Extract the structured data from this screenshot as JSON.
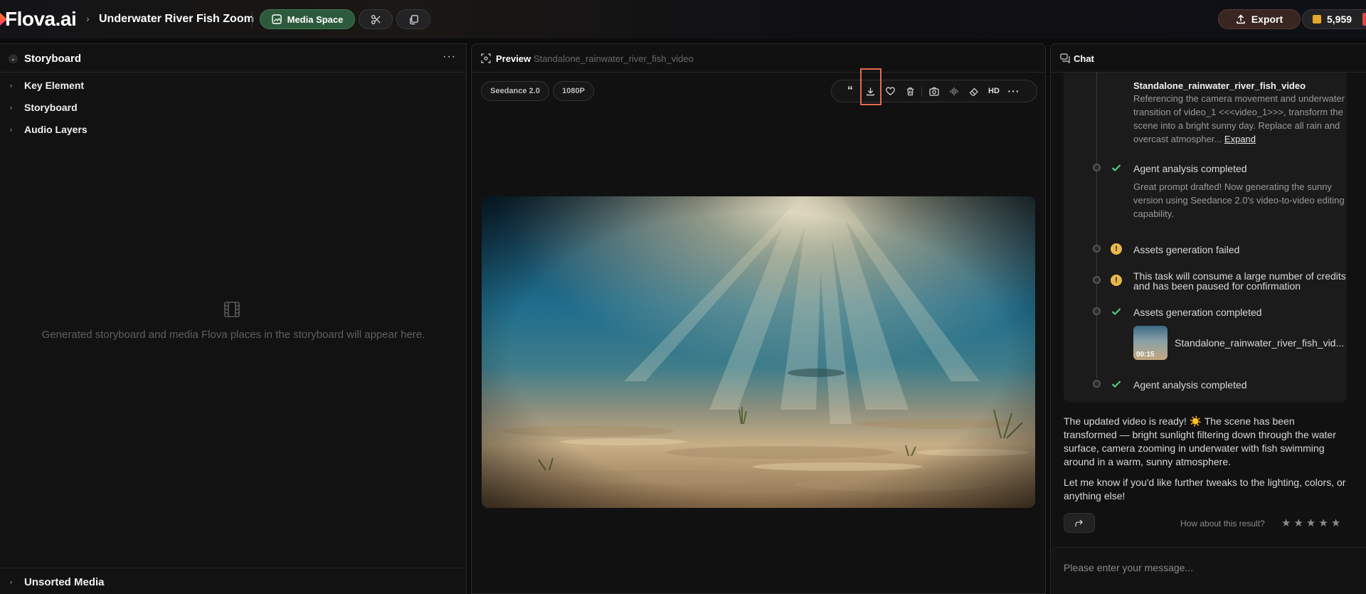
{
  "app": {
    "logo": "Flova.ai",
    "breadcrumb_sep": "›",
    "project_title": "Underwater River Fish Zoom"
  },
  "topbar": {
    "media_space_label": "Media Space",
    "scissors_icon": "scissors-icon",
    "copy_icon": "copy-icon",
    "export_label": "Export",
    "credits": "5,959",
    "colors": {
      "media_space": "#2d5a3c",
      "export": "#3a2621",
      "accent_orange": "#ff7a1a"
    }
  },
  "left_panel": {
    "title": "Storyboard",
    "tree": [
      {
        "label": "Key Element"
      },
      {
        "label": "Storyboard"
      },
      {
        "label": "Audio Layers"
      }
    ],
    "empty_text": "Generated storyboard and media Flova places in the storyboard will appear here.",
    "footer_label": "Unsorted Media"
  },
  "preview": {
    "title": "Preview",
    "filename": "Standalone_rainwater_river_fish_video",
    "model_pill": "Seedance 2.0",
    "resolution_pill": "1080P",
    "toolbar": {
      "quote_label": "“",
      "hd_label": "HD",
      "icons": [
        "quote-icon",
        "download-icon",
        "heart-icon",
        "trash-icon",
        "camera-icon",
        "waveform-icon",
        "eraser-icon",
        "hd-icon",
        "more-icon"
      ]
    }
  },
  "chat": {
    "title": "Chat",
    "steps": [
      {
        "title": "Standalone_rainwater_river_fish_video",
        "detail": "Referencing the camera movement and underwater transition of video_1 <<<video_1>>>, transform the scene into a bright sunny day. Replace all rain and overcast atmospher...",
        "expand": "Expand"
      },
      {
        "status": "check",
        "title": "Agent analysis completed",
        "detail": "Great prompt drafted! Now generating the sunny version using Seedance 2.0's video-to-video editing capability."
      },
      {
        "status": "warning",
        "title": "Assets generation failed"
      },
      {
        "status": "warning",
        "title": "This task will consume a large number of credits and has been paused for confirmation"
      },
      {
        "status": "check",
        "title": "Assets generation completed"
      },
      {
        "status": "check",
        "title": "Agent analysis completed"
      }
    ],
    "asset": {
      "duration": "00:15",
      "name": "Standalone_rainwater_river_fish_vid..."
    },
    "message_1": "The updated video is ready! ☀️ The scene has been transformed — bright sunlight filtering down through the water surface, camera zooming in underwater with fish swimming around in a warm, sunny atmosphere.",
    "message_2": "Let me know if you'd like further tweaks to the lighting, colors, or anything else!",
    "rating_label": "How about this result?",
    "rating": 0,
    "star_glyph": "★",
    "input_placeholder": "Please enter your message...",
    "colors": {
      "check": "#5cc97a",
      "warning": "#e8b84a"
    }
  }
}
